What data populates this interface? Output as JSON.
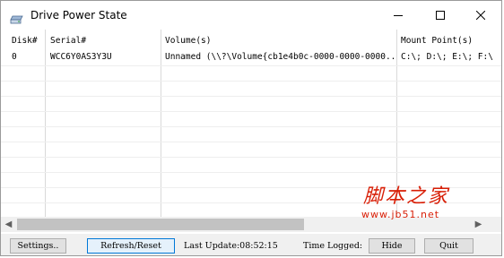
{
  "window": {
    "title": "Drive Power State",
    "icon": "drive-icon",
    "controls": [
      "minimize-icon",
      "maximize-icon",
      "close-icon"
    ]
  },
  "table": {
    "columns": [
      "Disk#",
      "Serial#",
      "Volume(s)",
      "Mount Point(s)"
    ],
    "rows": [
      [
        "0",
        "WCC6Y0AS3Y3U",
        "Unnamed (\\\\?\\Volume{cb1e4b0c-0000-0000-0000...",
        "C:\\; D:\\; E:\\; F:\\"
      ]
    ]
  },
  "status": {
    "settings_label": "Settings..",
    "refresh_label": "Refresh/Reset",
    "last_update": "Last Update:08:52:15",
    "time_logged": "Time Logged:",
    "hide_label": "Hide",
    "quit_label": "Quit"
  },
  "watermark": {
    "text_cn": "脚本之家",
    "url": "www.jb51.net",
    "color": "#d81e06"
  }
}
